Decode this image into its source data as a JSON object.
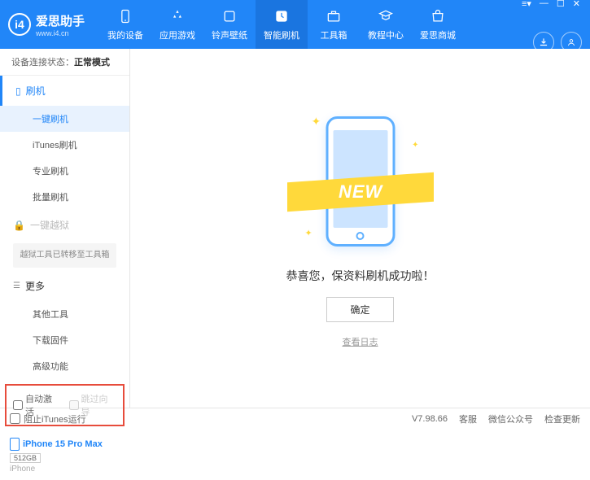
{
  "app": {
    "name": "爱思助手",
    "site": "www.i4.cn",
    "version": "V7.98.66"
  },
  "nav": [
    {
      "label": "我的设备"
    },
    {
      "label": "应用游戏"
    },
    {
      "label": "铃声壁纸"
    },
    {
      "label": "智能刷机"
    },
    {
      "label": "工具箱"
    },
    {
      "label": "教程中心"
    },
    {
      "label": "爱思商城"
    }
  ],
  "status": {
    "prefix": "设备连接状态：",
    "mode": "正常模式"
  },
  "sidebar": {
    "flash": {
      "title": "刷机",
      "items": [
        "一键刷机",
        "iTunes刷机",
        "专业刷机",
        "批量刷机"
      ]
    },
    "jailbreak": {
      "title": "一键越狱",
      "note": "越狱工具已转移至工具箱"
    },
    "more": {
      "title": "更多",
      "items": [
        "其他工具",
        "下载固件",
        "高级功能"
      ]
    }
  },
  "checkboxes": {
    "auto_activate": "自动激活",
    "skip_guide": "跳过向导"
  },
  "device": {
    "name": "iPhone 15 Pro Max",
    "storage": "512GB",
    "type": "iPhone"
  },
  "main": {
    "ribbon": "NEW",
    "message": "恭喜您，保资料刷机成功啦！",
    "ok": "确定",
    "view_log": "查看日志"
  },
  "footer": {
    "block_itunes": "阻止iTunes运行",
    "links": [
      "客服",
      "微信公众号",
      "检查更新"
    ]
  }
}
